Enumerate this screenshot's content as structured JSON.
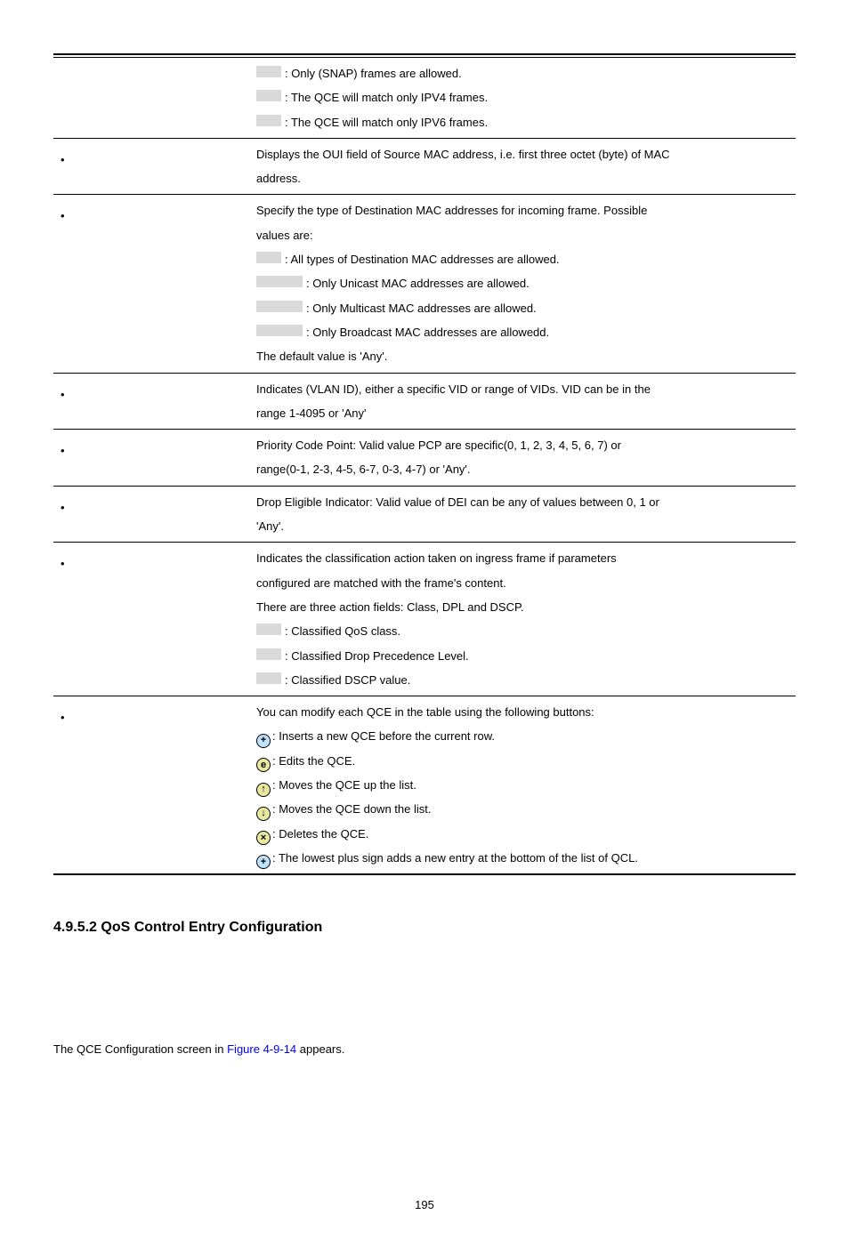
{
  "rows": [
    {
      "bullet": false,
      "lines": [
        {
          "grey_width": "w1",
          "text": ": Only (SNAP) frames are allowed."
        },
        {
          "grey_width": "w1",
          "text": ": The QCE will match only IPV4 frames."
        },
        {
          "grey_width": "w1",
          "text": ": The QCE will match only IPV6 frames."
        }
      ]
    },
    {
      "bullet": true,
      "lines": [
        {
          "plain": "Displays the OUI field of Source MAC address, i.e. first three octet (byte) of MAC"
        },
        {
          "plain": "address."
        }
      ]
    },
    {
      "bullet": true,
      "lines": [
        {
          "plain": "Specify the type of Destination MAC addresses for incoming frame. Possible"
        },
        {
          "plain": "values are:"
        },
        {
          "grey_width": "w1",
          "text": ": All types of Destination MAC addresses are allowed."
        },
        {
          "grey_width": "w2",
          "text": ": Only Unicast MAC addresses are allowed."
        },
        {
          "grey_width": "w2",
          "text": ": Only Multicast MAC addresses are allowed."
        },
        {
          "grey_width": "w2",
          "text": ": Only Broadcast MAC addresses are allowedd."
        },
        {
          "plain": "The default value is 'Any'."
        }
      ]
    },
    {
      "bullet": true,
      "lines": [
        {
          "plain": "Indicates (VLAN ID), either a specific VID or range of VIDs. VID can be in the"
        },
        {
          "plain": "range 1-4095 or 'Any'"
        }
      ]
    },
    {
      "bullet": true,
      "lines": [
        {
          "plain": "Priority Code Point: Valid value PCP are specific(0, 1, 2, 3, 4, 5, 6, 7) or"
        },
        {
          "plain": "range(0-1, 2-3, 4-5, 6-7, 0-3, 4-7) or 'Any'."
        }
      ]
    },
    {
      "bullet": true,
      "lines": [
        {
          "plain": "Drop Eligible Indicator: Valid value of DEI can be any of values between 0, 1 or"
        },
        {
          "plain": "'Any'."
        }
      ]
    },
    {
      "bullet": true,
      "lines": [
        {
          "plain": "Indicates the classification action taken on ingress frame if parameters"
        },
        {
          "plain": "configured are matched with the frame's content."
        },
        {
          "plain": "There are three action fields: Class, DPL and DSCP."
        },
        {
          "grey_width": "w1",
          "text": ": Classified QoS class."
        },
        {
          "grey_width": "w1",
          "text": ": Classified Drop Precedence Level."
        },
        {
          "grey_width": "w1",
          "text": ": Classified DSCP value."
        }
      ]
    },
    {
      "bullet": true,
      "lines": [
        {
          "plain": "You can modify each QCE in the table using the following buttons:"
        },
        {
          "icon": "plus",
          "icon_glyph": "+",
          "text": ": Inserts a new QCE before the current row."
        },
        {
          "icon": "edit",
          "icon_glyph": "e",
          "text": ": Edits the QCE."
        },
        {
          "icon": "up",
          "icon_glyph": "↑",
          "text": ": Moves the QCE up the list."
        },
        {
          "icon": "down",
          "icon_glyph": "↓",
          "text": ": Moves the QCE down the list."
        },
        {
          "icon": "del",
          "icon_glyph": "×",
          "text": ": Deletes the QCE."
        },
        {
          "icon": "plus2",
          "icon_glyph": "+",
          "text": ": The lowest plus sign adds a new entry at the bottom of the list of QCL."
        }
      ]
    }
  ],
  "heading": "4.9.5.2 QoS Control Entry Configuration",
  "footer_prefix": "The QCE Configuration screen in ",
  "footer_link": "Figure 4-9-14",
  "footer_suffix": " appears.",
  "page_number": "195"
}
